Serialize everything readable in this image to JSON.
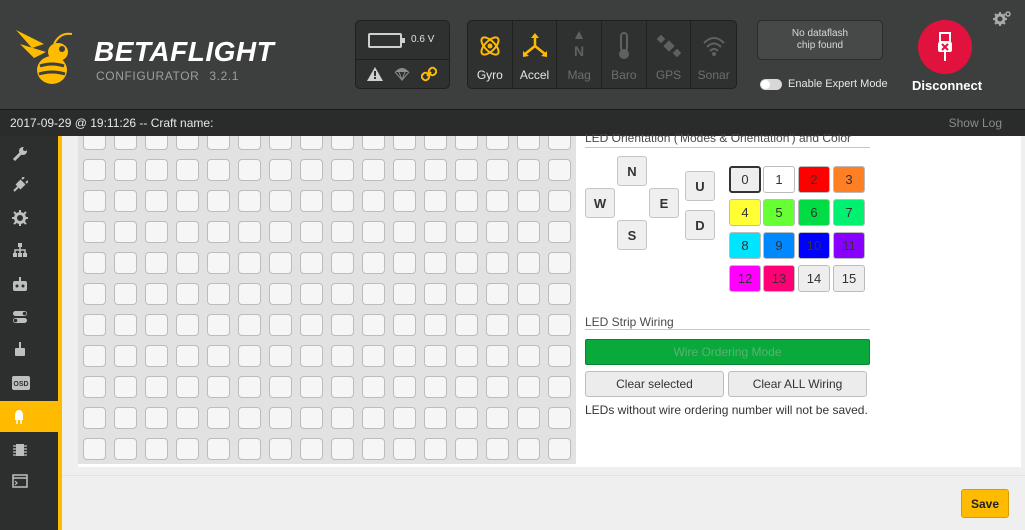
{
  "brand": {
    "name": "BETAFLIGHT",
    "subtitle": "CONFIGURATOR",
    "version": "3.2.1"
  },
  "battery": {
    "voltage": "0.6 V"
  },
  "sensors": [
    {
      "label": "Gyro",
      "icon": "gyro-icon",
      "active": true
    },
    {
      "label": "Accel",
      "icon": "accel-icon",
      "active": true
    },
    {
      "label": "Mag",
      "icon": "mag-icon",
      "active": false
    },
    {
      "label": "Baro",
      "icon": "baro-icon",
      "active": false
    },
    {
      "label": "GPS",
      "icon": "gps-icon",
      "active": false
    },
    {
      "label": "Sonar",
      "icon": "sonar-icon",
      "active": false
    }
  ],
  "dataflash": {
    "line1": "No dataflash",
    "line2": "chip found"
  },
  "expert_mode": {
    "label": "Enable Expert Mode"
  },
  "connection": {
    "label": "Disconnect"
  },
  "status": {
    "text": "2017-09-29 @ 19:11:26 -- Craft name:",
    "show_log": "Show Log"
  },
  "sidebar": {
    "items": [
      {
        "icon": "wrench-icon"
      },
      {
        "icon": "plug-icon"
      },
      {
        "icon": "gear-icon"
      },
      {
        "icon": "network-icon"
      },
      {
        "icon": "receiver-icon"
      },
      {
        "icon": "modes-icon"
      },
      {
        "icon": "motor-icon"
      },
      {
        "icon": "osd-icon"
      },
      {
        "icon": "led-icon",
        "active": true
      },
      {
        "icon": "chip-icon"
      },
      {
        "icon": "cli-icon"
      }
    ],
    "osd_label": "OSD"
  },
  "led_panel": {
    "orientation_title": "LED Orientation ('Modes & Orientation') and Color",
    "directions": {
      "n": "N",
      "w": "W",
      "e": "E",
      "s": "S",
      "u": "U",
      "d": "D"
    },
    "colors": [
      {
        "label": "0",
        "bg": "#eeeeee"
      },
      {
        "label": "1",
        "bg": "#ffffff"
      },
      {
        "label": "2",
        "bg": "#ff0000"
      },
      {
        "label": "3",
        "bg": "#ff7f24"
      },
      {
        "label": "4",
        "bg": "#ffff33"
      },
      {
        "label": "5",
        "bg": "#66ff33"
      },
      {
        "label": "6",
        "bg": "#00dd44"
      },
      {
        "label": "7",
        "bg": "#00f070"
      },
      {
        "label": "8",
        "bg": "#00e5ff"
      },
      {
        "label": "9",
        "bg": "#0088ff"
      },
      {
        "label": "10",
        "bg": "#0000ff"
      },
      {
        "label": "11",
        "bg": "#8800ff"
      },
      {
        "label": "12",
        "bg": "#ff00ff"
      },
      {
        "label": "13",
        "bg": "#ff0077"
      },
      {
        "label": "14",
        "bg": "#eeeeee"
      },
      {
        "label": "15",
        "bg": "#eeeeee"
      }
    ],
    "wiring_title": "LED Strip Wiring",
    "wire_mode_label": "Wire Ordering Mode",
    "clear_selected": "Clear selected",
    "clear_all": "Clear ALL Wiring",
    "note": "LEDs without wire ordering number will not be saved."
  },
  "footer": {
    "save": "Save"
  }
}
